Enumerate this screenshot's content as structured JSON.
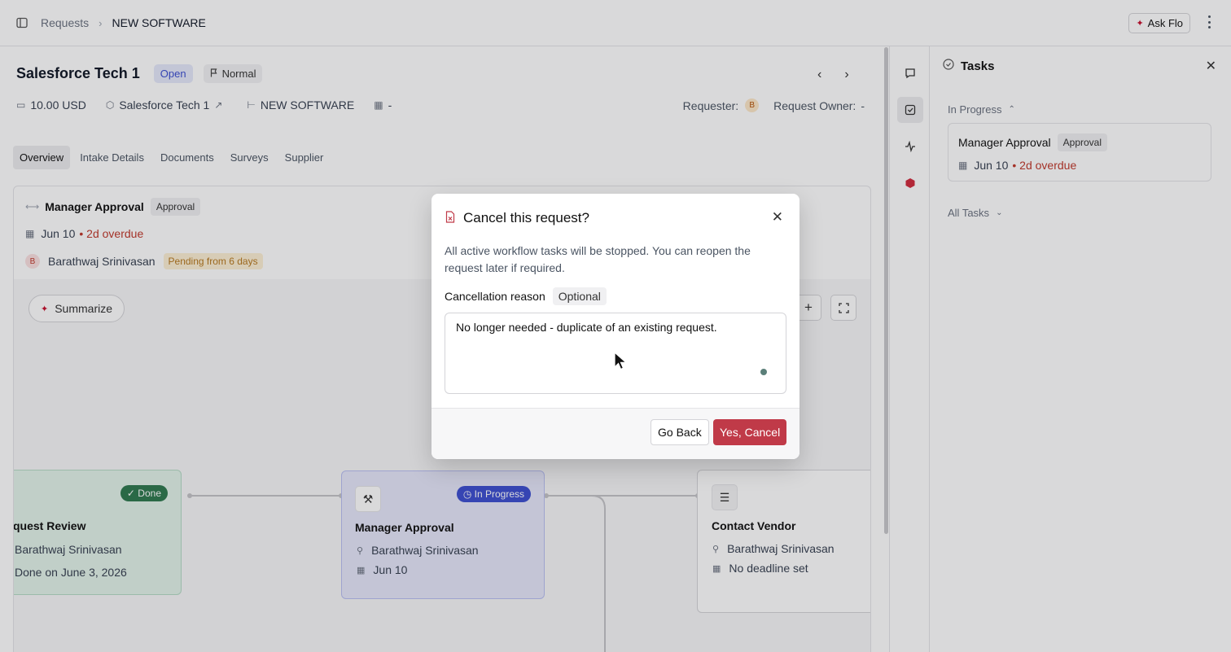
{
  "topbar": {
    "breadcrumb_root": "Requests",
    "breadcrumb_sep": "›",
    "breadcrumb_current": "NEW SOFTWARE",
    "ask_flo_label": "Ask Flo"
  },
  "request": {
    "title": "Salesforce Tech 1",
    "status": "Open",
    "priority": "Normal",
    "amount": "10.00 USD",
    "supplier": "Salesforce Tech 1",
    "workflow": "NEW SOFTWARE",
    "date": "-",
    "requester_label": "Requester:",
    "requester_initial": "B",
    "owner_label": "Request Owner:",
    "owner_value": "-"
  },
  "tabs": [
    "Overview",
    "Intake Details",
    "Documents",
    "Surveys",
    "Supplier"
  ],
  "approval_card": {
    "title": "Manager Approval",
    "chip": "Approval",
    "due": "Jun 10",
    "overdue": "• 2d overdue",
    "assignee_initial": "B",
    "assignee": "Barathwaj Srinivasan",
    "pending": "Pending from 6 days"
  },
  "canvas": {
    "summarize_label": "Summarize",
    "nodes": [
      {
        "title": "Request Review",
        "visible_title": "quest Review",
        "status": "✓ Done",
        "assignee": "Barathwaj Srinivasan",
        "detail": "Done on June 3, 2026"
      },
      {
        "title": "Manager Approval",
        "status": "In Progress",
        "assignee": "Barathwaj Srinivasan",
        "detail": "Jun 10"
      },
      {
        "title": "Contact Vendor",
        "status": "",
        "assignee": "Barathwaj Srinivasan",
        "detail": "No deadline set"
      }
    ]
  },
  "tasks_panel": {
    "title": "Tasks",
    "in_progress_label": "In Progress",
    "all_tasks_label": "All Tasks",
    "task": {
      "title": "Manager Approval",
      "chip": "Approval",
      "due": "Jun 10",
      "overdue": "• 2d overdue"
    }
  },
  "modal": {
    "title": "Cancel this request?",
    "description": "All active workflow tasks will be stopped. You can reopen the request later if required.",
    "reason_label": "Cancellation reason",
    "optional_label": "Optional",
    "reason_value": "No longer needed - duplicate of an existing request.",
    "go_back_label": "Go Back",
    "confirm_label": "Yes, Cancel"
  },
  "colors": {
    "accent_red": "#c03a48",
    "status_open_bg": "#e5e9fb",
    "in_progress": "#3d4fd1",
    "done": "#2f7a4f",
    "overdue": "#c0392b"
  }
}
